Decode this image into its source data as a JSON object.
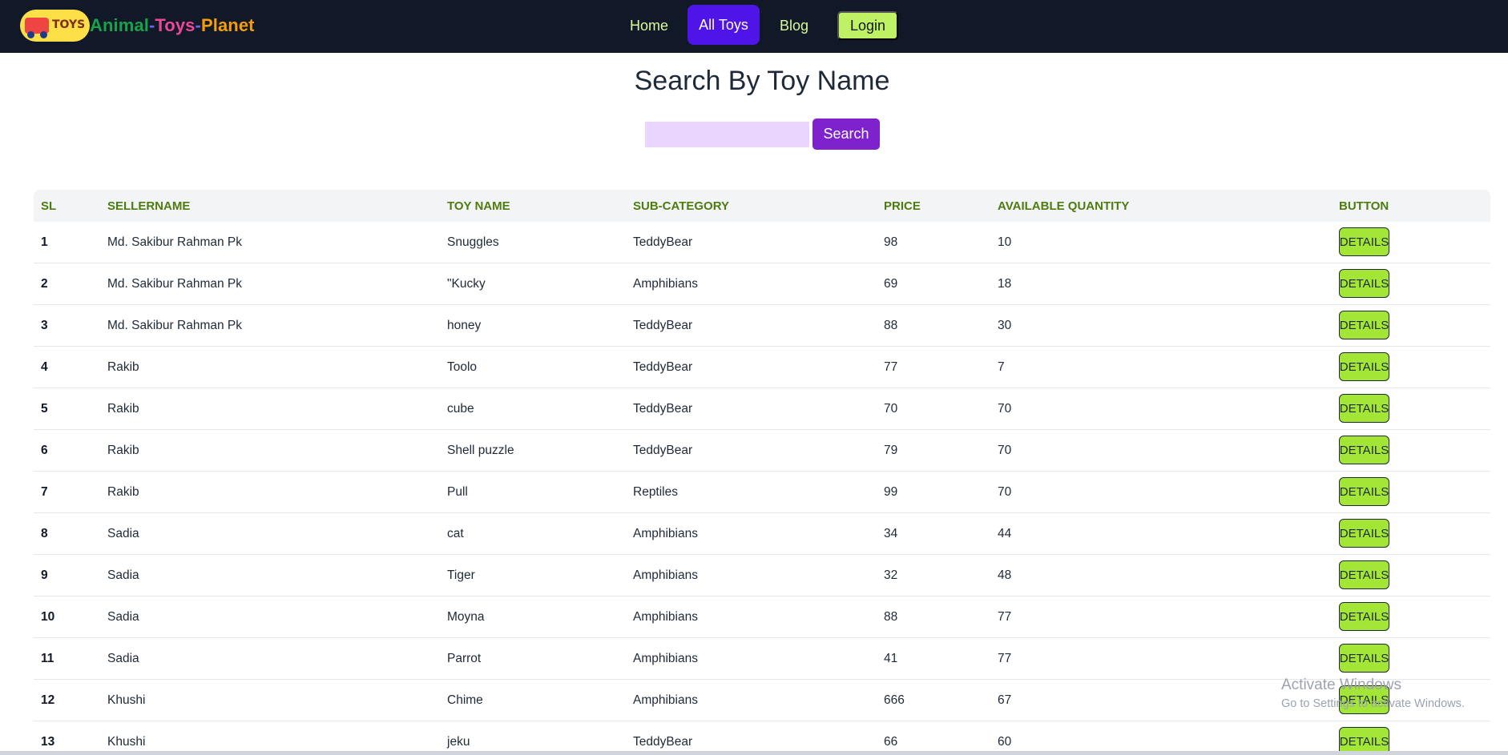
{
  "brand": {
    "logo_text": "TOYS",
    "part1": "Animal",
    "sep1": "-",
    "part2": "Toys",
    "sep2": "-",
    "part3": "Planet"
  },
  "nav": {
    "home": "Home",
    "all_toys": "All Toys",
    "blog": "Blog",
    "login": "Login"
  },
  "search": {
    "title": "Search By Toy Name",
    "placeholder": "",
    "button": "Search"
  },
  "table": {
    "headers": [
      "SL",
      "SELLERNAME",
      "TOY NAME",
      "SUB-CATEGORY",
      "PRICE",
      "AVAILABLE QUANTITY",
      "BUTTON"
    ],
    "details_label": "DETAILS",
    "rows": [
      {
        "sl": "1",
        "seller": "Md. Sakibur Rahman Pk",
        "toy": "Snuggles",
        "sub": "TeddyBear",
        "price": "98",
        "qty": "10"
      },
      {
        "sl": "2",
        "seller": "Md. Sakibur Rahman Pk",
        "toy": "\"Kucky",
        "sub": "Amphibians",
        "price": "69",
        "qty": "18"
      },
      {
        "sl": "3",
        "seller": "Md. Sakibur Rahman Pk",
        "toy": "honey",
        "sub": "TeddyBear",
        "price": "88",
        "qty": "30"
      },
      {
        "sl": "4",
        "seller": "Rakib",
        "toy": "Toolo",
        "sub": "TeddyBear",
        "price": "77",
        "qty": "7"
      },
      {
        "sl": "5",
        "seller": "Rakib",
        "toy": "cube",
        "sub": "TeddyBear",
        "price": "70",
        "qty": "70"
      },
      {
        "sl": "6",
        "seller": "Rakib",
        "toy": "Shell puzzle",
        "sub": "TeddyBear",
        "price": "79",
        "qty": "70"
      },
      {
        "sl": "7",
        "seller": "Rakib",
        "toy": "Pull",
        "sub": "Reptiles",
        "price": "99",
        "qty": "70"
      },
      {
        "sl": "8",
        "seller": "Sadia",
        "toy": "cat",
        "sub": "Amphibians",
        "price": "34",
        "qty": "44"
      },
      {
        "sl": "9",
        "seller": "Sadia",
        "toy": "Tiger",
        "sub": "Amphibians",
        "price": "32",
        "qty": "48"
      },
      {
        "sl": "10",
        "seller": "Sadia",
        "toy": "Moyna",
        "sub": "Amphibians",
        "price": "88",
        "qty": "77"
      },
      {
        "sl": "11",
        "seller": "Sadia",
        "toy": "Parrot",
        "sub": "Amphibians",
        "price": "41",
        "qty": "77"
      },
      {
        "sl": "12",
        "seller": "Khushi",
        "toy": "Chime",
        "sub": "Amphibians",
        "price": "666",
        "qty": "67"
      },
      {
        "sl": "13",
        "seller": "Khushi",
        "toy": "jeku",
        "sub": "TeddyBear",
        "price": "66",
        "qty": "60"
      }
    ]
  },
  "watermark": {
    "line1": "Activate Windows",
    "line2": "Go to Settings to activate Windows."
  }
}
